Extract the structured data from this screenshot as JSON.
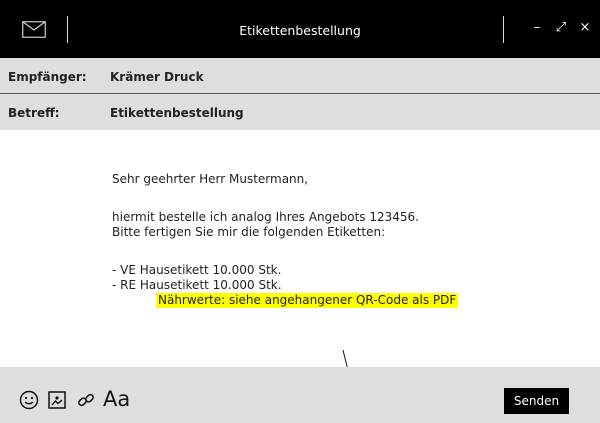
{
  "window": {
    "title": "Etikettenbestellung",
    "minimize": "–",
    "maximize": "⤢",
    "close": "×"
  },
  "header": {
    "to_label": "Empfänger:",
    "to_value": "Krämer Druck",
    "subject_label": "Betreff:",
    "subject_value": "Etikettenbestellung"
  },
  "message": {
    "greeting": "Sehr geehrter Herr Mustermann,",
    "line1": "hiermit bestelle ich analog Ihres Angebots 123456.",
    "line2": "Bitte fertigen Sie mir die folgenden Etiketten:",
    "item1": "- VE Hausetikett 10.000 Stk.",
    "item2": "- RE Hausetikett 10.000 Stk.",
    "highlight": "Nährwerte: siehe angehangener QR-Code als PDF",
    "highlight_color": "#ffff00"
  },
  "toolbar": {
    "format_label": "Aa",
    "send_label": "Senden",
    "icons": [
      "emoji-icon",
      "image-icon",
      "link-icon"
    ]
  }
}
